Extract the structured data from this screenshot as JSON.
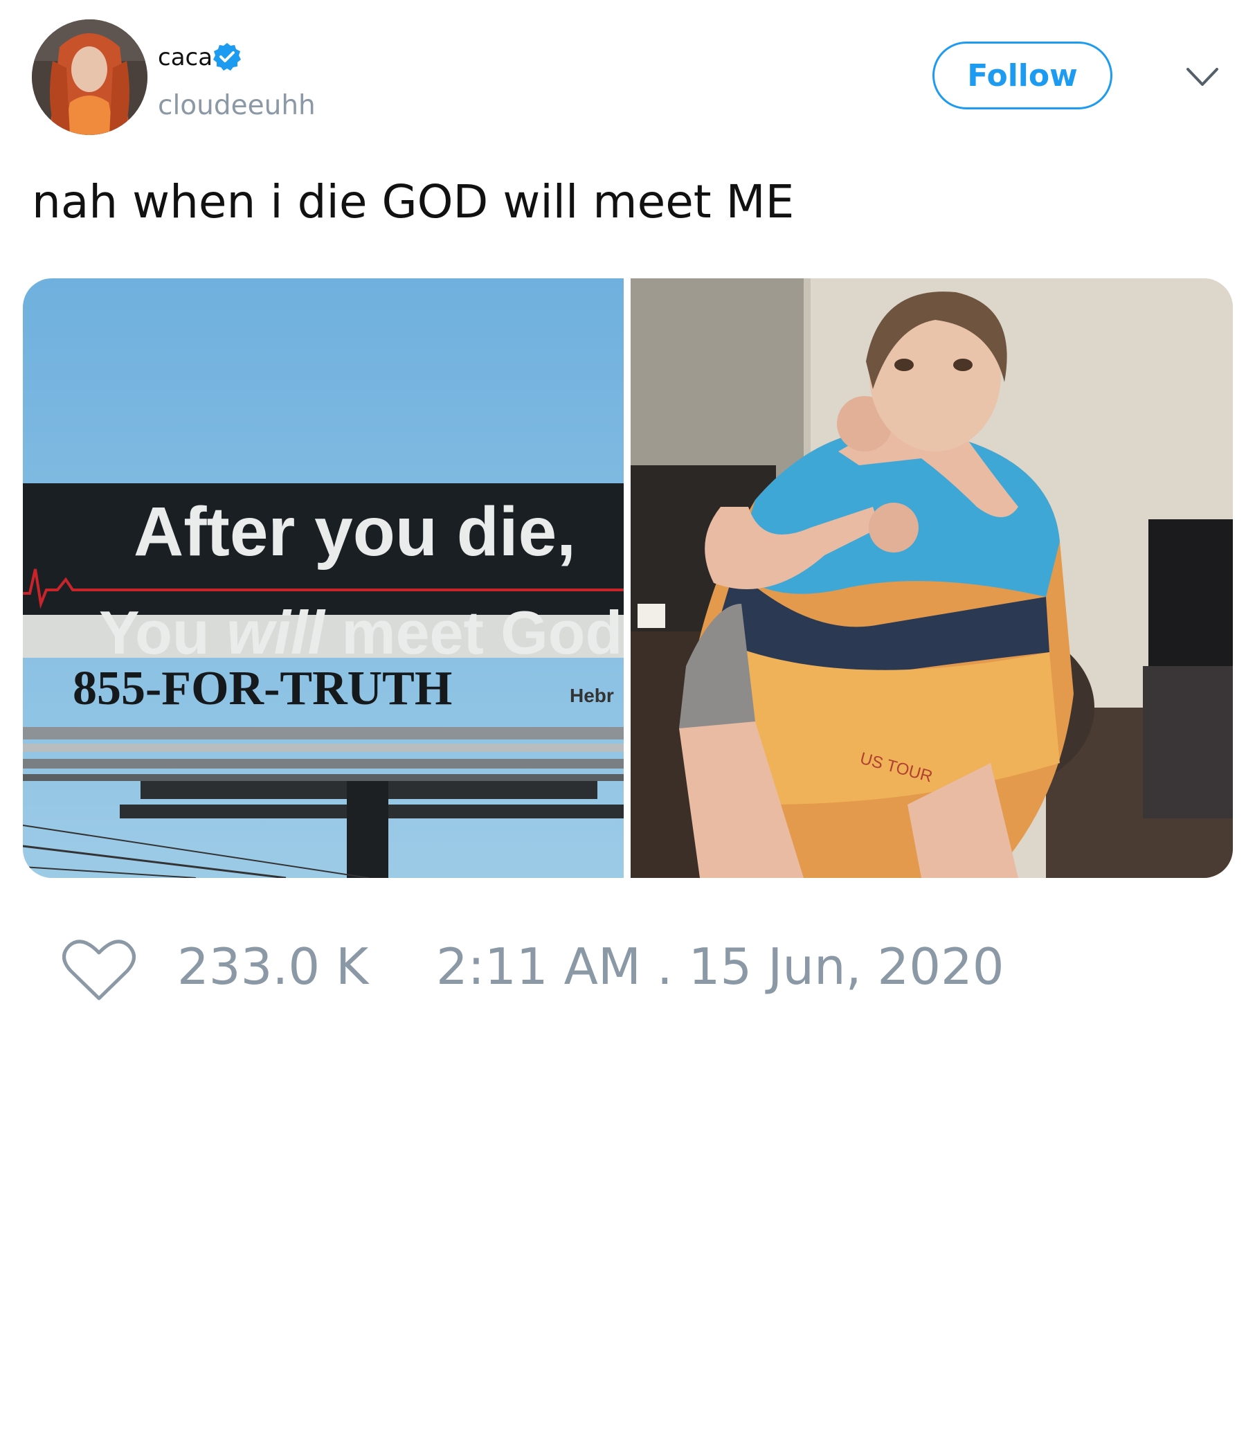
{
  "author": {
    "display_name": "caca",
    "handle": "cloudeeuhh",
    "verified": true,
    "avatar_icon": "user-avatar"
  },
  "follow_button": {
    "label": "Follow"
  },
  "menu": {
    "icon": "chevron-down-icon"
  },
  "tweet": {
    "text": "nah when i die GOD will meet ME"
  },
  "media": {
    "billboard": {
      "line1": "After you die,",
      "line2_pre": "You ",
      "line2_em": "will",
      "line2_post": " meet God",
      "phone": "855-FOR-TRUTH",
      "sponsor": "Hebr"
    },
    "photo_right": {
      "shirt_text": "US TOUR"
    }
  },
  "footer": {
    "like_icon": "heart-icon",
    "likes": "233.0 K",
    "timestamp": "2:11 AM . 15 Jun, 2020"
  },
  "colors": {
    "accent": "#1d9bf0",
    "muted": "#8b98a5",
    "text": "#111111"
  }
}
